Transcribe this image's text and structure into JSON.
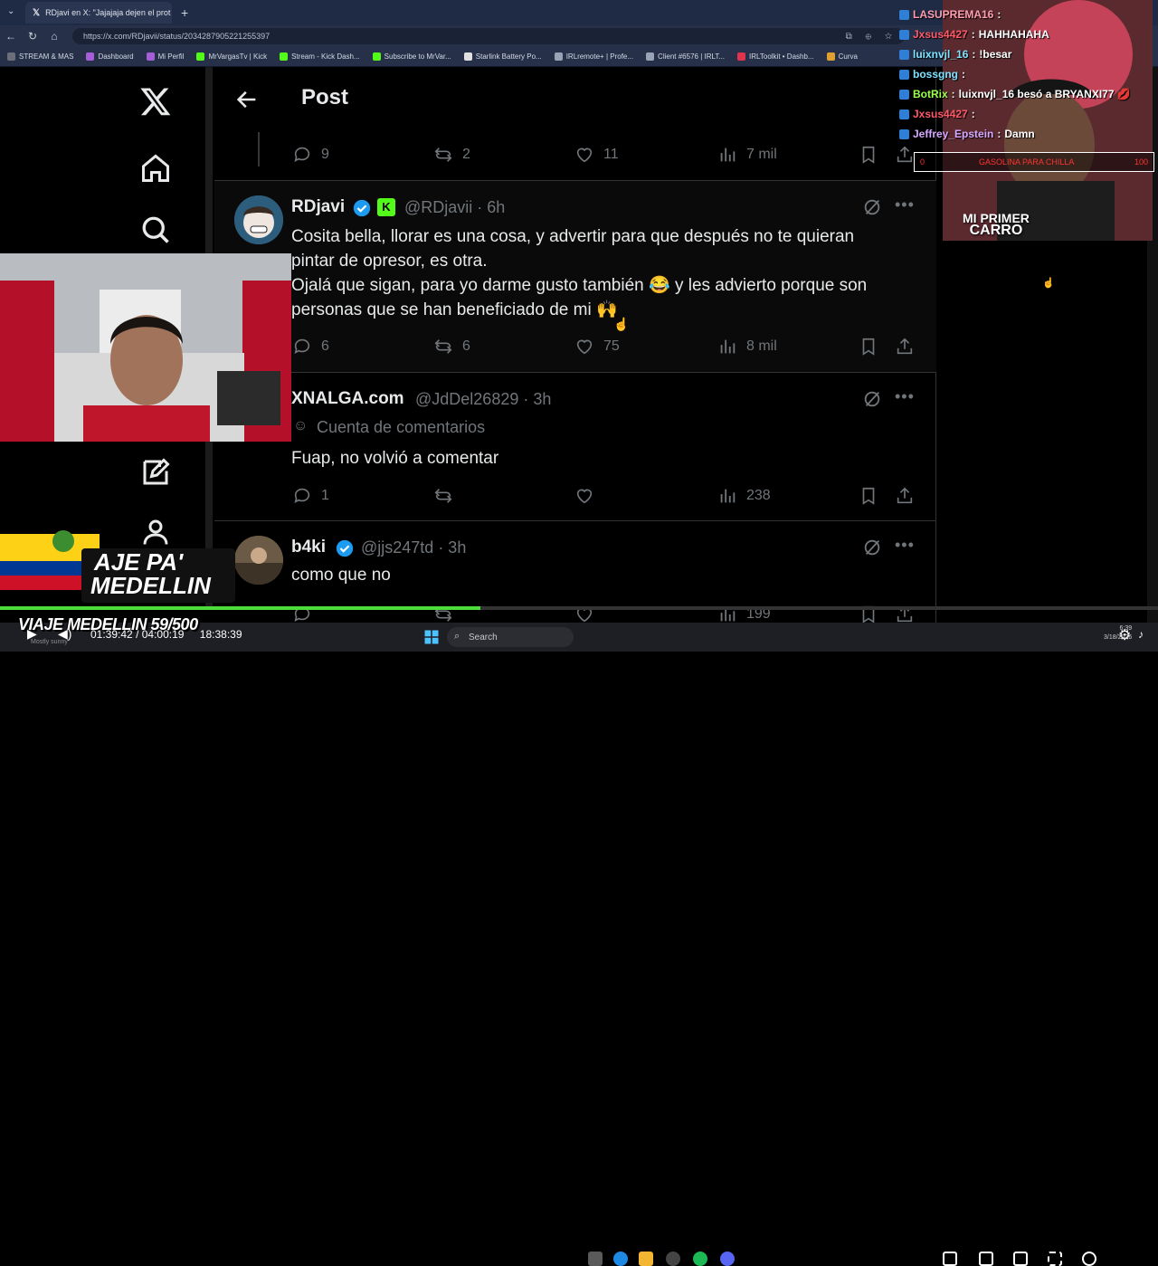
{
  "browser": {
    "tab_title": "RDjavi en X: \"Jajajaja dejen el prot",
    "tab_close": "✕",
    "new_tab": "+",
    "url": "https://x.com/RDjavii/status/2034287905221255397",
    "bookmarks": [
      {
        "label": "STREAM & MAS",
        "color": "#6a6f7a"
      },
      {
        "label": "Dashboard",
        "color": "#a55fd6"
      },
      {
        "label": "Mi Perfil",
        "color": "#a55fd6"
      },
      {
        "label": "MrVargasTv | Kick",
        "color": "#53fc18"
      },
      {
        "label": "Stream - Kick Dash...",
        "color": "#53fc18"
      },
      {
        "label": "Subscribe to MrVar...",
        "color": "#53fc18"
      },
      {
        "label": "Starlink Battery Po...",
        "color": "#e0e0e0"
      },
      {
        "label": "IRLremote+ | Profe...",
        "color": "#9aa3b5"
      },
      {
        "label": "Client #6576 | IRLT...",
        "color": "#9aa3b5"
      },
      {
        "label": "IRLToolkit • Dashb...",
        "color": "#e0334d"
      },
      {
        "label": "Curva",
        "color": "#e0a030"
      }
    ]
  },
  "x": {
    "header_title": "Post",
    "first_actions": {
      "replies": "9",
      "reposts": "2",
      "likes": "11",
      "views": "7 mil"
    },
    "posts": [
      {
        "name": "RDjavi",
        "handle": "@RDjavii · 6h",
        "lines": [
          "Cosita bella, llorar es una cosa, y advertir para que después no te quieran",
          "pintar de opresor, es otra.",
          "Ojalá que sigan, para yo darme gusto también 😂 y les advierto porque son",
          "personas que se han beneficiado de mi 🙌"
        ],
        "replies": "6",
        "reposts": "6",
        "likes": "75",
        "views": "8 mil"
      },
      {
        "name": "XNALGA.com",
        "handle": "@JdDel26829 · 3h",
        "label": "Cuenta de comentarios",
        "lines": [
          "Fuap, no volvió a comentar"
        ],
        "replies": "1",
        "reposts": "",
        "likes": "",
        "views": "238"
      },
      {
        "name": "b4ki",
        "handle": "@jjs247td · 3h",
        "lines": [
          "como que no"
        ],
        "replies": "",
        "reposts": "",
        "likes": "",
        "views": "199"
      }
    ]
  },
  "stream": {
    "chat": [
      {
        "user": "LASUPREMA16",
        "msg": "",
        "color": "#ff9db0"
      },
      {
        "user": "Jxsus4427",
        "msg": "HAHHAHAHA",
        "color": "#ff5a6a"
      },
      {
        "user": "luixnvjl_16",
        "msg": "!besar",
        "color": "#7fe3ff"
      },
      {
        "user": "bossgng",
        "msg": "",
        "color": "#7fe3ff"
      },
      {
        "user": "BotRix",
        "msg": "luixnvjl_16 besó a BRYANXI77 💋",
        "color": "#9aff4d"
      },
      {
        "user": "Jxsus4427",
        "msg": "",
        "color": "#ff5a6a"
      },
      {
        "user": "Jeffrey_Epstein",
        "msg": "Damn",
        "color": "#d6a8ff"
      }
    ],
    "donation_left": "0",
    "donation_text": "GASOLINA PARA CHILLA",
    "donation_right": "100",
    "car_title_1": "MI PRIMER",
    "car_title_2": "CARRO",
    "banner_1": "AJE PA'",
    "banner_2": "MEDELLIN",
    "viaje": "VIAJE MEDELLIN 59/500",
    "progress_fraction": 0.415,
    "time_elapsed": "01:39:42",
    "time_remaining": "04:00:19",
    "time_total": "18:38:39",
    "subtitle": "Mostly sunny"
  },
  "taskbar": {
    "search_placeholder": "Search",
    "clock_time": "6:39",
    "clock_date": "3/18/2026"
  }
}
